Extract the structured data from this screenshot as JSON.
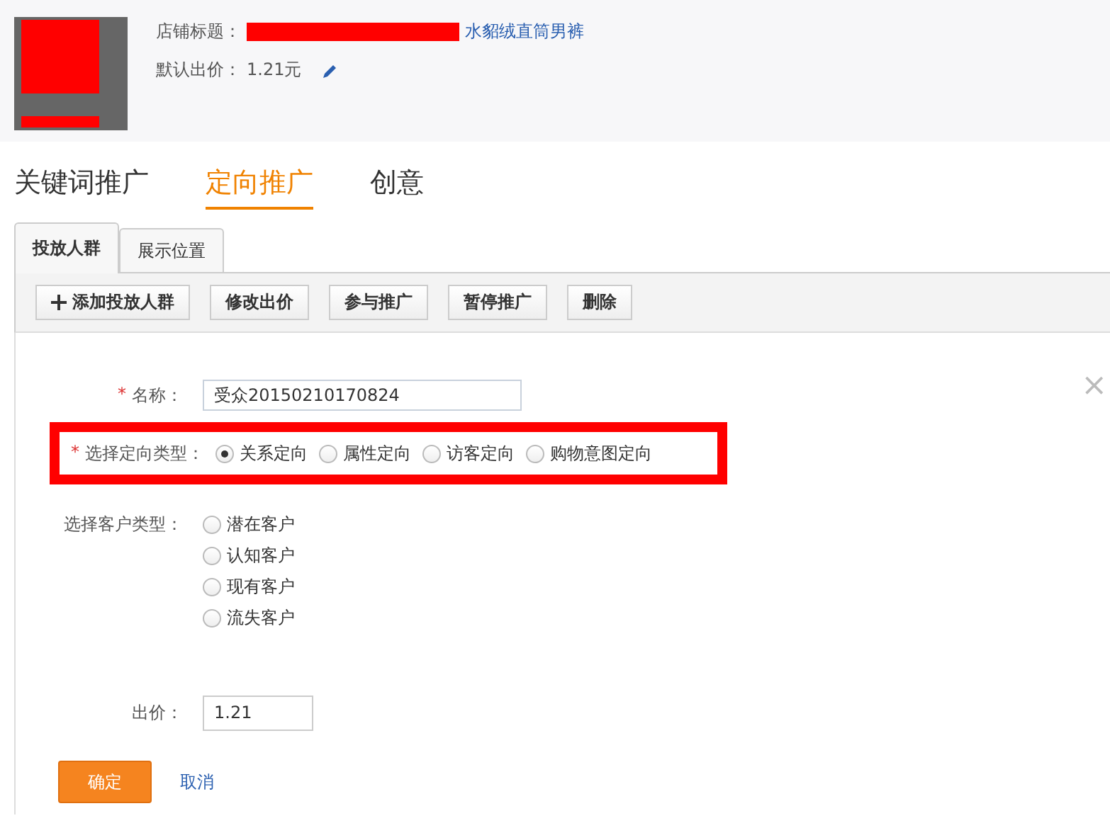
{
  "product": {
    "title_label": "店铺标题：",
    "title_value": "水貂绒直筒男裤",
    "price_label": "默认出价：",
    "price_value": "1.21元"
  },
  "main_tabs": [
    {
      "label": "关键词推广",
      "selected": false
    },
    {
      "label": "定向推广",
      "selected": true
    },
    {
      "label": "创意",
      "selected": false
    }
  ],
  "sub_tabs": [
    {
      "label": "投放人群",
      "selected": true
    },
    {
      "label": "展示位置",
      "selected": false
    }
  ],
  "toolbar": [
    {
      "label": "添加投放人群",
      "kind": "add"
    },
    {
      "label": "修改出价",
      "kind": "plain"
    },
    {
      "label": "参与推广",
      "kind": "plain"
    },
    {
      "label": "暂停推广",
      "kind": "plain"
    },
    {
      "label": "删除",
      "kind": "plain"
    }
  ],
  "form": {
    "close": "×",
    "name": {
      "label": "名称：",
      "mark": "*",
      "value": "受众20150210170824"
    },
    "targeting": {
      "label": "选择定向类型：",
      "mark": "*",
      "options": [
        {
          "label": "关系定向",
          "selected": true
        },
        {
          "label": "属性定向",
          "selected": false
        },
        {
          "label": "访客定向",
          "selected": false
        },
        {
          "label": "购物意图定向",
          "selected": false
        }
      ]
    },
    "customer": {
      "label": "选择客户类型：",
      "options": [
        {
          "label": "潜在客户",
          "selected": false
        },
        {
          "label": "认知客户",
          "selected": false
        },
        {
          "label": "现有客户",
          "selected": false
        },
        {
          "label": "流失客户",
          "selected": false
        }
      ]
    },
    "bid": {
      "label": "出价：",
      "value": "1.21"
    },
    "confirm": "确定",
    "cancel": "取消"
  }
}
